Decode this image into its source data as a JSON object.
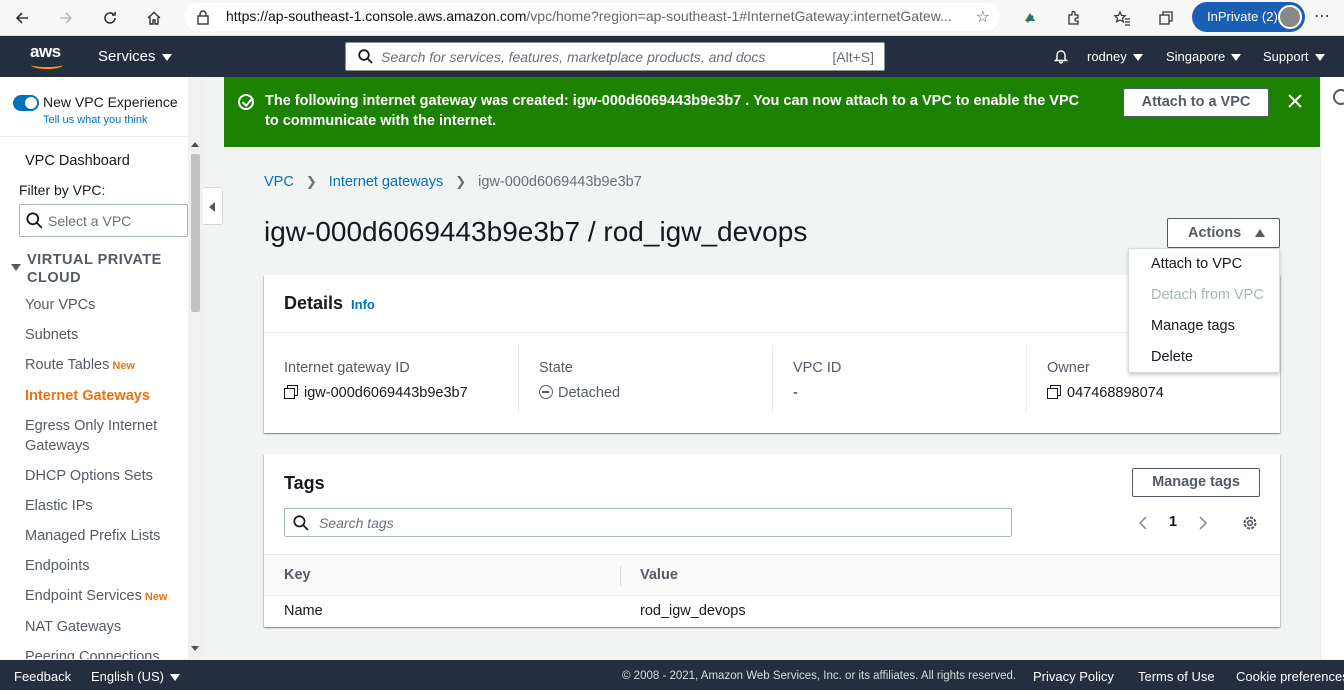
{
  "browser": {
    "url_domain": "https://ap-southeast-1.console.aws.amazon.com",
    "url_rest": "/vpc/home?region=ap-southeast-1#InternetGateway:internetGatew...",
    "inprivate_label": "InPrivate (2)"
  },
  "awsnav": {
    "logo_text": "aws",
    "services_label": "Services",
    "search_placeholder": "Search for services, features, marketplace products, and docs",
    "search_shortcut": "[Alt+S]",
    "user_label": "rodney",
    "region_label": "Singapore",
    "support_label": "Support"
  },
  "sidebar": {
    "new_vpc_label": "New VPC Experience",
    "tell_us_label": "Tell us what you think",
    "dashboard_label": "VPC Dashboard",
    "filter_label": "Filter by VPC:",
    "filter_placeholder": "Select a VPC",
    "section_line1": "VIRTUAL PRIVATE",
    "section_line2": "CLOUD",
    "new_badge": "New",
    "items": [
      {
        "label": "Your VPCs"
      },
      {
        "label": "Subnets"
      },
      {
        "label": "Route Tables"
      },
      {
        "label": "Internet Gateways"
      },
      {
        "label": "Egress Only Internet Gateways"
      },
      {
        "label": "DHCP Options Sets"
      },
      {
        "label": "Elastic IPs"
      },
      {
        "label": "Managed Prefix Lists"
      },
      {
        "label": "Endpoints"
      },
      {
        "label": "Endpoint Services"
      },
      {
        "label": "NAT Gateways"
      },
      {
        "label": "Peering Connections"
      }
    ]
  },
  "flash": {
    "message": "The following internet gateway was created: igw-000d6069443b9e3b7 . You can now attach to a VPC to enable the VPC to communicate with the internet.",
    "attach_button": "Attach to a VPC"
  },
  "breadcrumb": {
    "root": "VPC",
    "parent": "Internet gateways",
    "current": "igw-000d6069443b9e3b7"
  },
  "page": {
    "title": "igw-000d6069443b9e3b7 / rod_igw_devops",
    "actions_label": "Actions"
  },
  "actions_menu": {
    "attach": "Attach to VPC",
    "detach": "Detach from VPC",
    "manage_tags": "Manage tags",
    "delete": "Delete"
  },
  "details": {
    "heading": "Details",
    "info_label": "Info",
    "igw_id_label": "Internet gateway ID",
    "igw_id_value": "igw-000d6069443b9e3b7",
    "state_label": "State",
    "state_value": "Detached",
    "vpc_id_label": "VPC ID",
    "vpc_id_value": "-",
    "owner_label": "Owner",
    "owner_value": "047468898074"
  },
  "tags": {
    "heading": "Tags",
    "manage_button": "Manage tags",
    "search_placeholder": "Search tags",
    "page_number": "1",
    "col_key": "Key",
    "col_value": "Value",
    "rows": [
      {
        "key": "Name",
        "value": "rod_igw_devops"
      }
    ]
  },
  "footer": {
    "feedback": "Feedback",
    "language": "English (US)",
    "copyright": "© 2008 - 2021, Amazon Web Services, Inc. or its affiliates. All rights reserved.",
    "privacy": "Privacy Policy",
    "terms": "Terms of Use",
    "cookies": "Cookie preferences"
  },
  "colors": {
    "aws_nav": "#232f3e",
    "success_green": "#1d8102",
    "link_blue": "#0073bb",
    "active_orange": "#ec7211"
  }
}
